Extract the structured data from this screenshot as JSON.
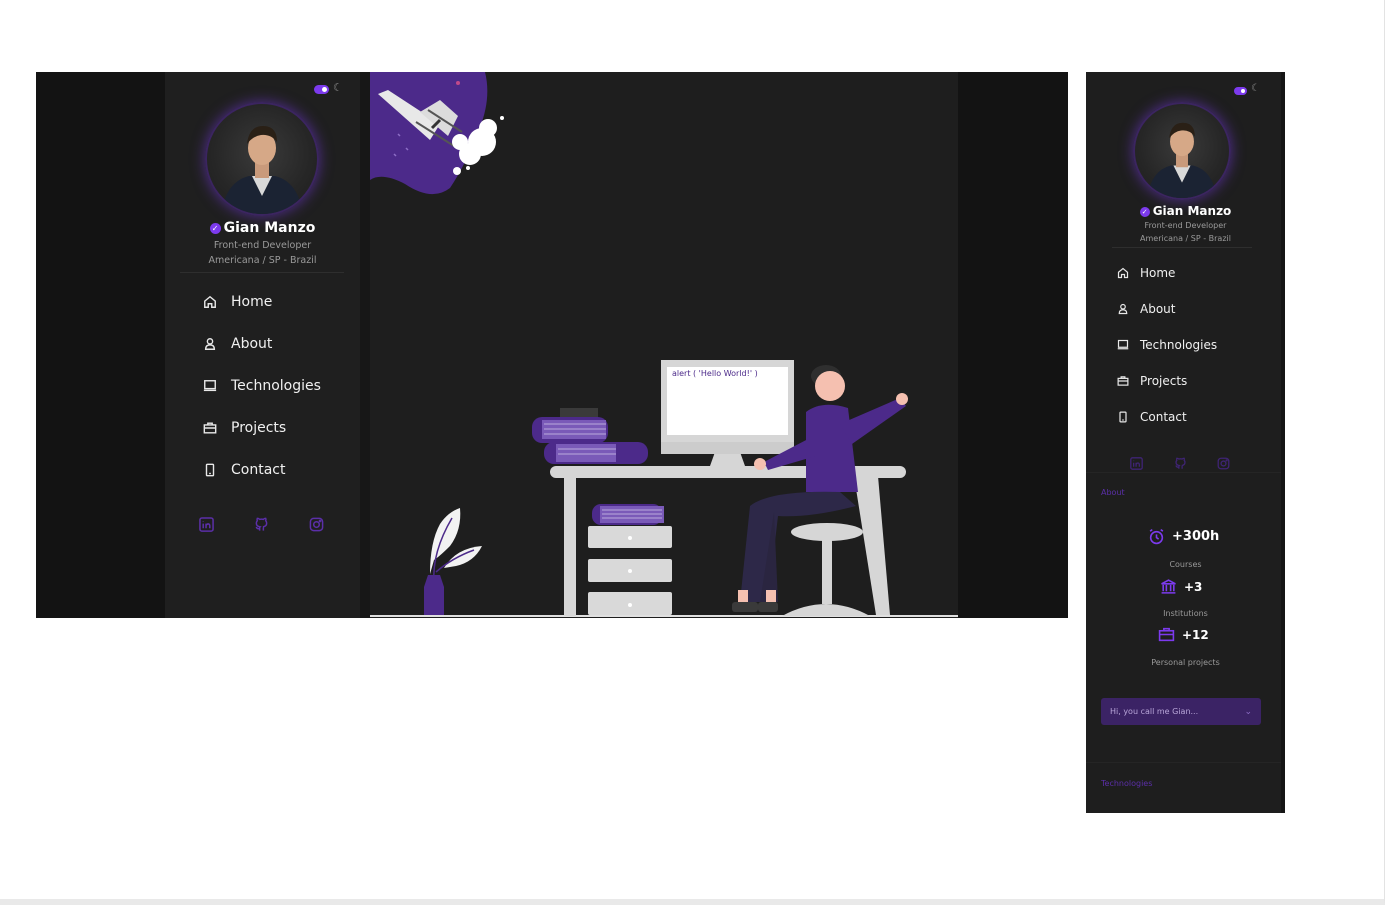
{
  "profile": {
    "name": "Gian Manzo",
    "role": "Front-end Developer",
    "location": "Americana / SP - Brazil"
  },
  "theme": {
    "accent": "#7c3aed",
    "mode": "dark"
  },
  "nav": {
    "items": [
      {
        "label": "Home",
        "icon": "home-icon"
      },
      {
        "label": "About",
        "icon": "user-icon"
      },
      {
        "label": "Technologies",
        "icon": "laptop-icon"
      },
      {
        "label": "Projects",
        "icon": "briefcase-icon"
      },
      {
        "label": "Contact",
        "icon": "phone-icon"
      }
    ]
  },
  "social": [
    "linkedin-icon",
    "github-icon",
    "instagram-icon"
  ],
  "hero": {
    "code_text": "alert ( 'Hello World!' )"
  },
  "about": {
    "section_label": "About",
    "stats": [
      {
        "value": "+300h",
        "label": "Courses",
        "icon": "alarm-clock-icon"
      },
      {
        "value": "+3",
        "label": "Institutions",
        "icon": "institution-icon"
      },
      {
        "value": "+12",
        "label": "Personal projects",
        "icon": "briefcase-icon"
      }
    ],
    "greeting": "Hi, you call me Gian..."
  },
  "technologies": {
    "section_label": "Technologies"
  }
}
